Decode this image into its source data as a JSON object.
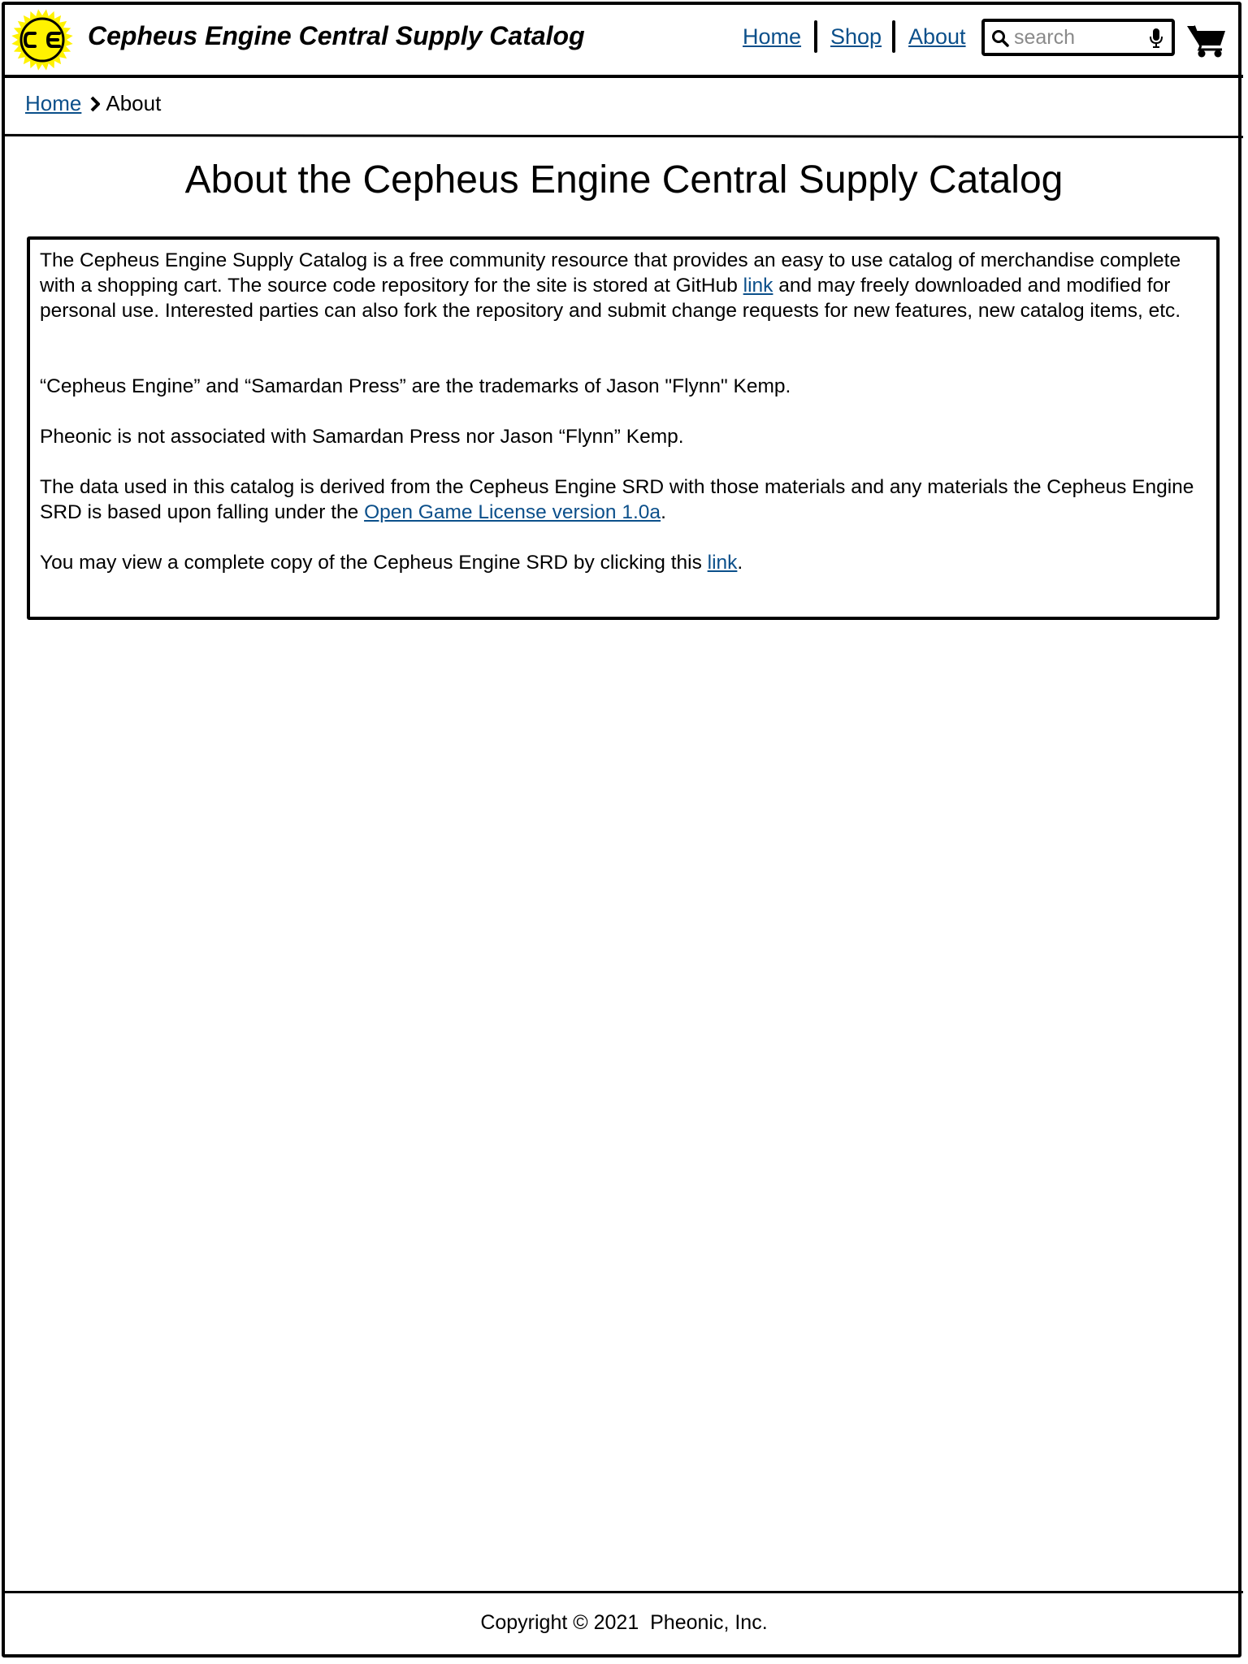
{
  "header": {
    "site_title": "Cepheus Engine Central Supply Catalog",
    "logo_text": "CE",
    "nav": [
      {
        "label": "Home"
      },
      {
        "label": "Shop"
      },
      {
        "label": "About"
      }
    ],
    "search": {
      "placeholder": "search",
      "value": ""
    },
    "icons": {
      "search": "search-icon",
      "mic": "microphone-icon",
      "cart": "shopping-cart-icon",
      "logo": "sun-logo-icon"
    }
  },
  "breadcrumb": {
    "home_label": "Home",
    "current_label": "About"
  },
  "main": {
    "title": "About the Cepheus Engine Central Supply Catalog",
    "p1_before": "The Cepheus Engine Supply Catalog is a free community resource that provides an easy to use catalog of merchandise complete with a shopping cart. The source code repository for the site is stored at GitHub ",
    "p1_link": "link",
    "p1_after": " and may freely downloaded and modified for personal use. Interested parties can also fork the repository and submit change requests for new features, new catalog items, etc.",
    "p2": "“Cepheus Engine” and “Samardan Press” are the trademarks of Jason \"Flynn\" Kemp.",
    "p3": "Pheonic is not associated with Samardan Press nor Jason “Flynn” Kemp.",
    "p4_before": "The data used in this catalog is derived from the Cepheus Engine SRD with those materials and any materials the Cepheus Engine SRD is based upon falling under the ",
    "p4_link": "Open Game License version 1.0a",
    "p4_after": ".",
    "p5_before": "You may view a complete copy of the Cepheus Engine SRD by clicking this ",
    "p5_link": "link",
    "p5_after": "."
  },
  "footer": {
    "copyright": "Copyright © 2021  Pheonic, Inc."
  },
  "colors": {
    "link": "#0b4f8a",
    "logo_fill": "#fff200",
    "border": "#000000"
  }
}
